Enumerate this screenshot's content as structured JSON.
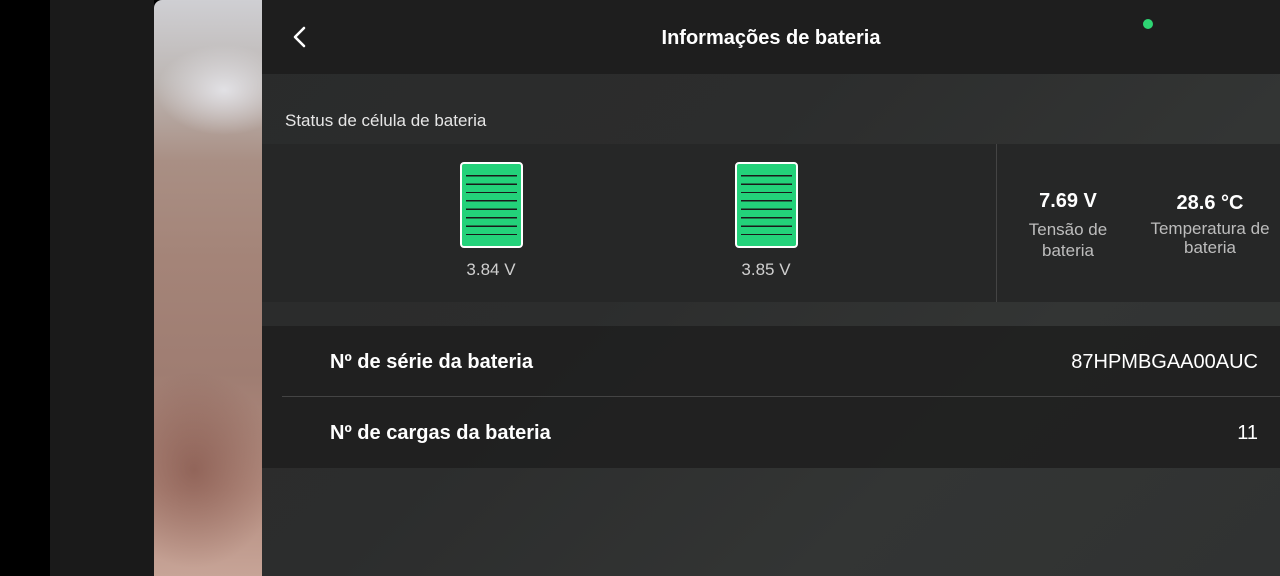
{
  "header": {
    "title": "Informações de bateria",
    "back_icon": "chevron-left-icon"
  },
  "status_indicator_color": "#2ed573",
  "cell_status": {
    "label": "Status de célula de bateria",
    "cells": [
      {
        "voltage": "3.84 V",
        "level": 1.0
      },
      {
        "voltage": "3.85 V",
        "level": 1.0
      }
    ],
    "battery_voltage": {
      "value": "7.69 V",
      "label": "Tensão de bateria"
    },
    "battery_temperature": {
      "value": "28.6 °C",
      "label": "Temperatura de bateria"
    }
  },
  "details": {
    "rows": [
      {
        "label": "Nº de série da bateria",
        "value": "87HPMBGAA00AUC"
      },
      {
        "label": "Nº de cargas da bateria",
        "value": "11"
      }
    ]
  },
  "colors": {
    "battery_fill": "#23d27a",
    "header_bg": "#1e1e1e",
    "panel_bg": "#2c2d2d"
  }
}
